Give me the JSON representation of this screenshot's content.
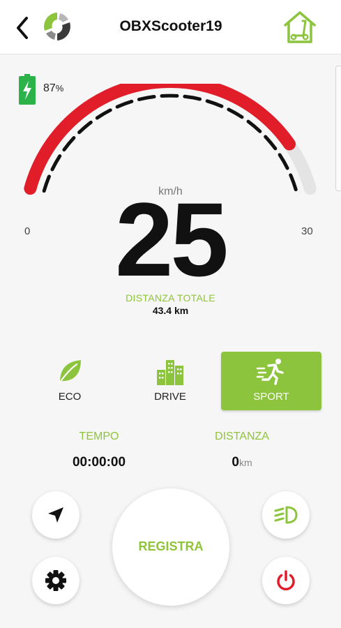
{
  "header": {
    "title": "OBXScooter19",
    "back_icon": "back-chevron-icon",
    "logo": "brand-logo",
    "home_icon": "scooter-home-icon"
  },
  "battery": {
    "value": "87",
    "unit": "%",
    "icon": "battery-charging-icon"
  },
  "gauge": {
    "unit": "km/h",
    "speed": "25",
    "min": "0",
    "max": "30",
    "fill_fraction": 0.87
  },
  "total_distance": {
    "label": "DISTANZA TOTALE",
    "value": "43.4 km"
  },
  "modes": [
    {
      "label": "ECO",
      "icon": "leaf-icon",
      "active": false
    },
    {
      "label": "DRIVE",
      "icon": "city-icon",
      "active": false
    },
    {
      "label": "SPORT",
      "icon": "running-person-icon",
      "active": true
    }
  ],
  "stats": {
    "time_label": "TEMPO",
    "time_value": "00:00:00",
    "distance_label": "DISTANZA",
    "distance_value": "0",
    "distance_unit": "km"
  },
  "controls": {
    "record_label": "REGISTRA",
    "navigate_icon": "navigation-arrow-icon",
    "lights_icon": "headlight-icon",
    "settings_icon": "gear-icon",
    "power_icon": "power-icon"
  },
  "colors": {
    "accent": "#8cc43d",
    "gauge_fill": "#e11d2a",
    "gauge_track": "#e4e4e4",
    "power": "#e11d2a"
  }
}
